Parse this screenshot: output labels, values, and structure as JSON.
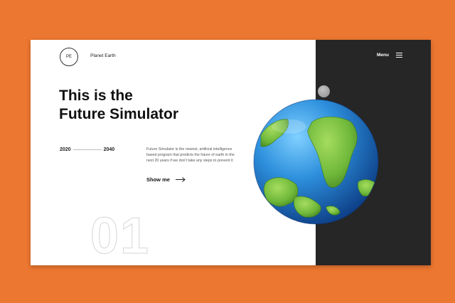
{
  "brand": {
    "logo_initials": "PE",
    "name": "Planet Earth"
  },
  "nav": {
    "menu_label": "Menu"
  },
  "hero": {
    "title_line1": "This is the",
    "title_line2": "Future Simulator",
    "year_start": "2020",
    "year_end": "2040",
    "description": "Future Simulator is the newest, artificial intelligence based program that predicts the future of earth in the next 20 years if we don't take any steps to prevent it",
    "cta_label": "Show me",
    "slide_number": "01"
  },
  "colors": {
    "background": "#ec7730",
    "panel_dark": "#262626",
    "ocean": "#2d8fdc",
    "land": "#6fb83a"
  },
  "icons": [
    "hamburger-icon",
    "arrow-right-icon",
    "globe-illustration",
    "moon-illustration"
  ]
}
